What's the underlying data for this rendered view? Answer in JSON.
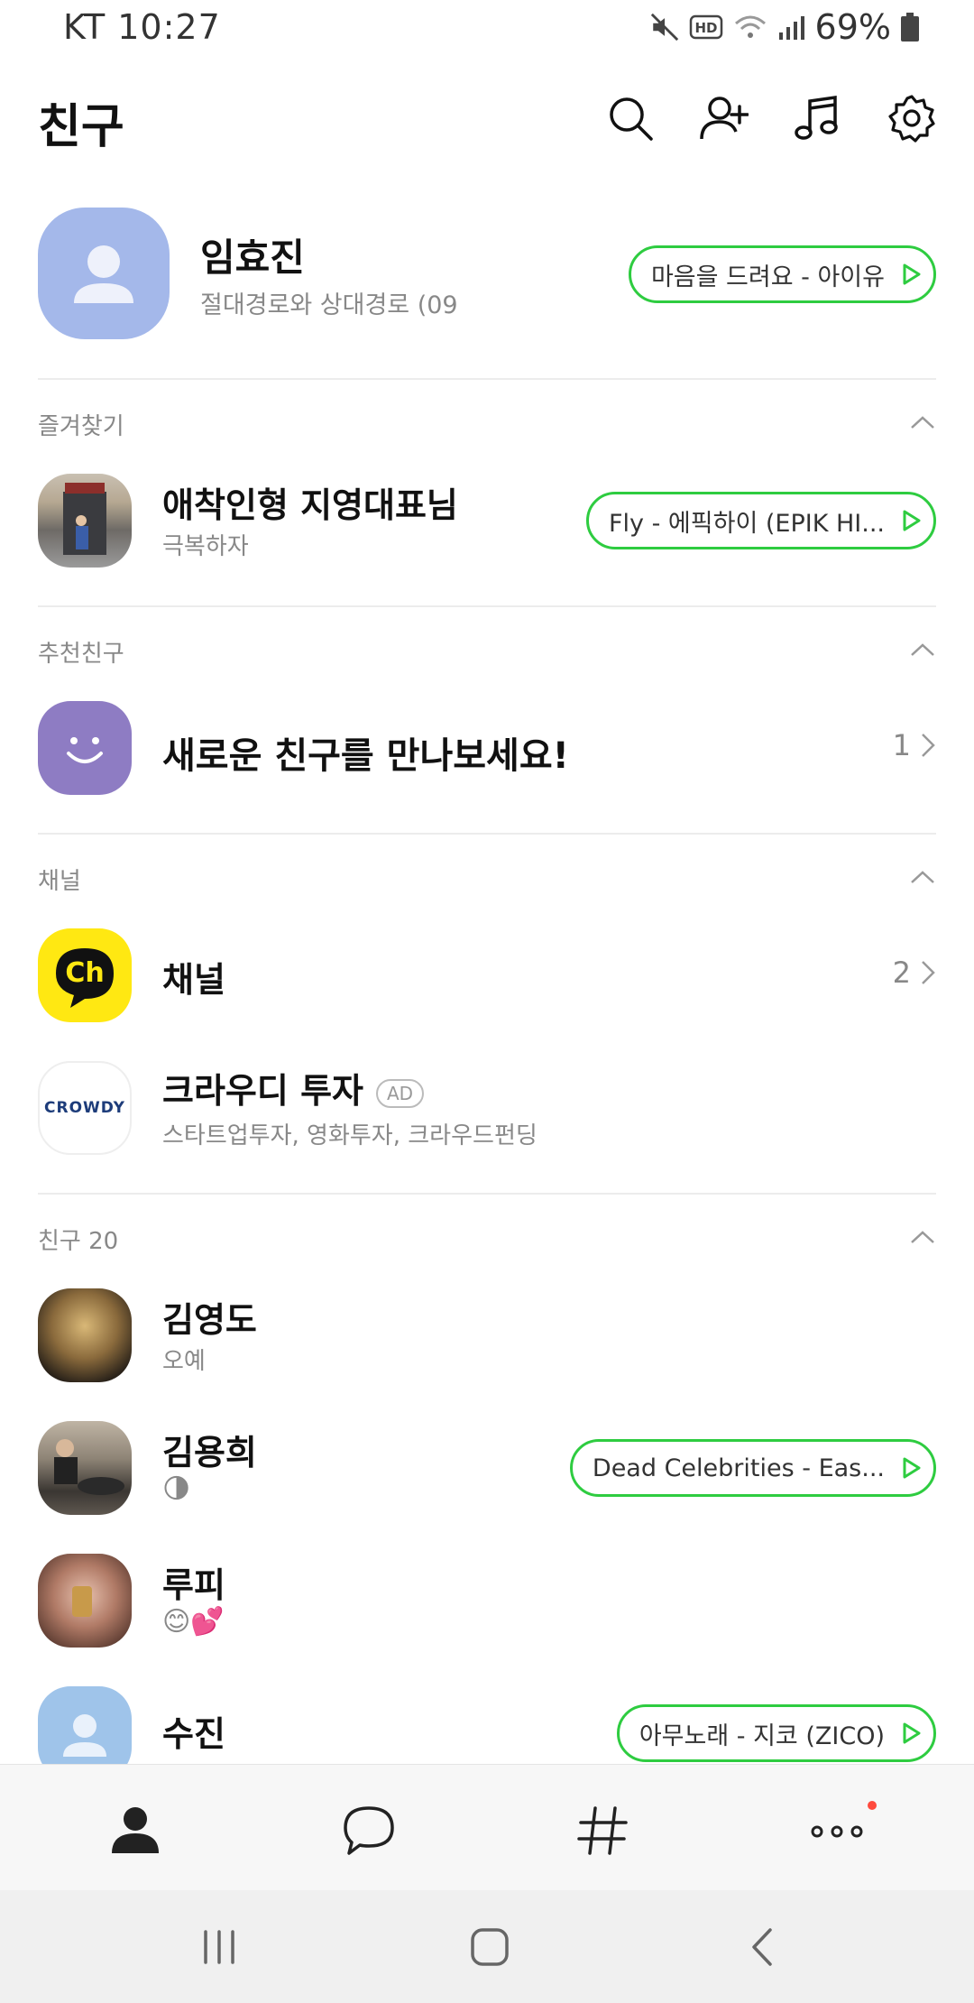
{
  "status": {
    "carrier_time": "KT 10:27",
    "battery": "69%"
  },
  "header": {
    "title": "친구"
  },
  "profile": {
    "name": "임효진",
    "status": "절대경로와 상대경로 (09",
    "music": "마음을 드려요 - 아이유"
  },
  "sections": {
    "favorites": {
      "title": "즐겨찾기"
    },
    "recommend": {
      "title": "추천친구"
    },
    "channel": {
      "title": "채널"
    },
    "friends": {
      "title": "친구 20"
    }
  },
  "favorite": {
    "name": "애착인형 지영대표님",
    "status": "극복하자",
    "music": "Fly - 에픽하이 (EPIK HI..."
  },
  "recommend_item": {
    "label": "새로운 친구를 만나보세요!",
    "count": "1"
  },
  "channel_item": {
    "name": "채널",
    "count": "2",
    "icon_text": "Ch"
  },
  "ad_item": {
    "name": "크라우디 투자",
    "badge": "AD",
    "desc": "스타트업투자, 영화투자, 크라우드펀딩",
    "logo_text": "CROWDY"
  },
  "friends": [
    {
      "name": "김영도",
      "status": "오예",
      "music": ""
    },
    {
      "name": "김용희",
      "status": "🌗",
      "music": "Dead Celebrities - Eas..."
    },
    {
      "name": "루피",
      "status": "😊💕",
      "music": ""
    },
    {
      "name": "수진",
      "status": "",
      "music": "아무노래 - 지코 (ZICO)"
    }
  ],
  "colors": {
    "accent_green": "#2ecc40",
    "kakao_yellow": "#ffe812",
    "profile_blue": "#a4b8ea",
    "recommend_purple": "#8e7cc3",
    "badge_red": "#ff4a3d"
  }
}
